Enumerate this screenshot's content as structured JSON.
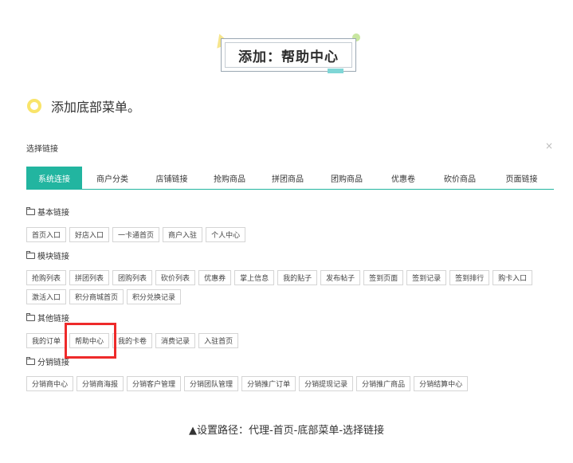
{
  "title_card": {
    "title": "添加：帮助中心"
  },
  "section": {
    "heading": "添加底部菜单。"
  },
  "dialog": {
    "title": "选择链接",
    "close": "×",
    "tabs": [
      "系统连接",
      "商户分类",
      "店铺链接",
      "抢购商品",
      "拼团商品",
      "团购商品",
      "优惠卷",
      "砍价商品",
      "页面链接"
    ],
    "active_tab": 0,
    "groups": [
      {
        "label": "基本链接",
        "links": [
          "首页入口",
          "好店入口",
          "一卡通首页",
          "商户入驻",
          "个人中心"
        ]
      },
      {
        "label": "模块链接",
        "links": [
          "抢购列表",
          "拼团列表",
          "团购列表",
          "砍价列表",
          "优惠券",
          "掌上信息",
          "我的贴子",
          "发布帖子",
          "签到页面",
          "签到记录",
          "签到排行",
          "购卡入口",
          "激活入口",
          "积分商城首页",
          "积分兑换记录"
        ]
      },
      {
        "label": "其他链接",
        "links": [
          "我的订单",
          "帮助中心",
          "我的卡卷",
          "消费记录",
          "入驻首页"
        ]
      },
      {
        "label": "分销链接",
        "links": [
          "分销商中心",
          "分销商海报",
          "分销客户管理",
          "分销团队管理",
          "分销推广订单",
          "分销提现记录",
          "分销推广商品",
          "分销结算中心"
        ]
      }
    ],
    "highlighted_link": "帮助中心"
  },
  "caption": "▲设置路径：代理-首页-底部菜单-选择链接",
  "colors": {
    "accent": "#22b5a0",
    "highlight": "#ee2a2a",
    "ring": "#f9e46a"
  }
}
